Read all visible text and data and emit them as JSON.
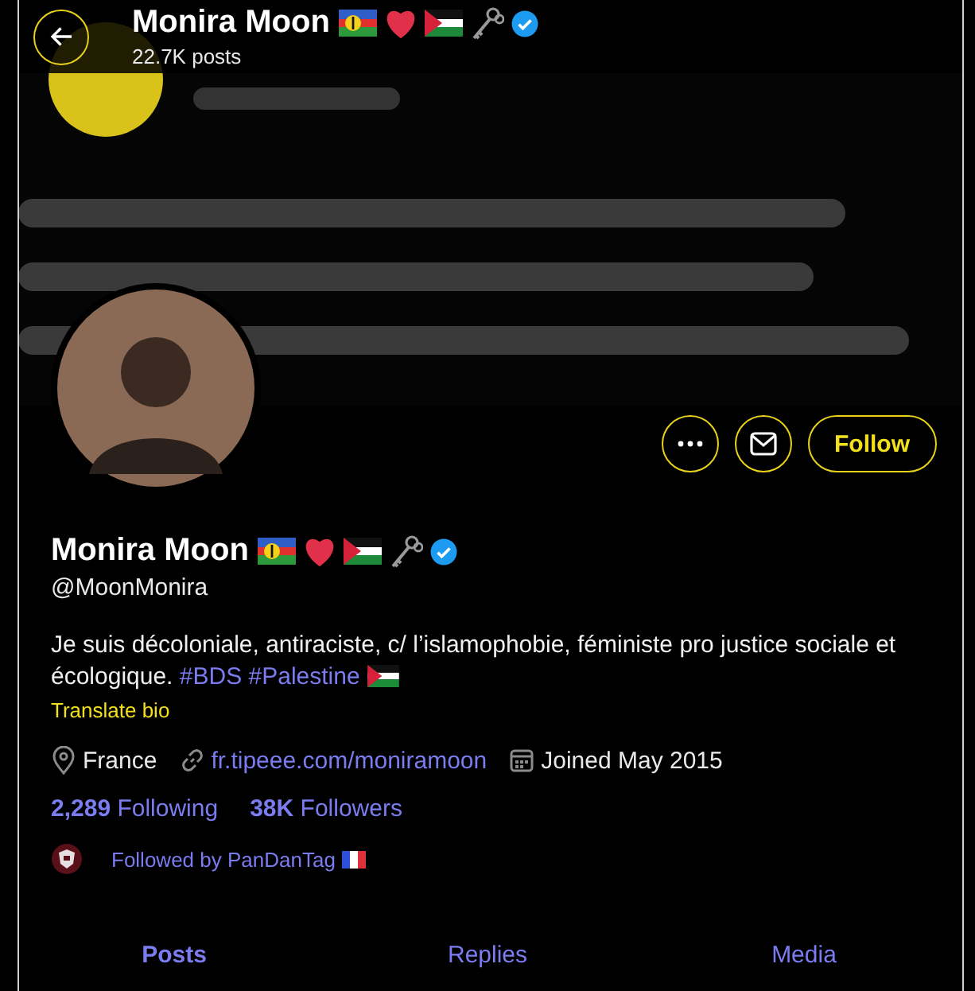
{
  "header": {
    "name": "Monira Moon",
    "verified": true,
    "posts_count": "22.7K posts"
  },
  "actions": {
    "follow": "Follow"
  },
  "profile": {
    "name": "Monira Moon",
    "verified": true,
    "handle": "@MoonMonira",
    "bio": [
      {
        "kind": "text",
        "text": "Je suis décoloniale, antiraciste, c/ l’islamophobie, féministe pro justice sociale et écologique."
      },
      {
        "kind": "hashtag",
        "text": "#BDS"
      },
      {
        "kind": "hashtag",
        "text": "#Palestine"
      }
    ],
    "translate": "Translate bio",
    "location": "France",
    "website": "fr.tipeee.com/moniramoon",
    "joined": "Joined May 2015",
    "stats": [
      {
        "count": "2,289",
        "label": "Following"
      },
      {
        "count": "38K",
        "label": "Followers"
      }
    ],
    "followed_by": "Followed by PanDanTag"
  },
  "tabs": [
    {
      "label": "Posts",
      "selected": true
    },
    {
      "label": "Replies",
      "selected": false
    },
    {
      "label": "Media",
      "selected": false
    }
  ]
}
